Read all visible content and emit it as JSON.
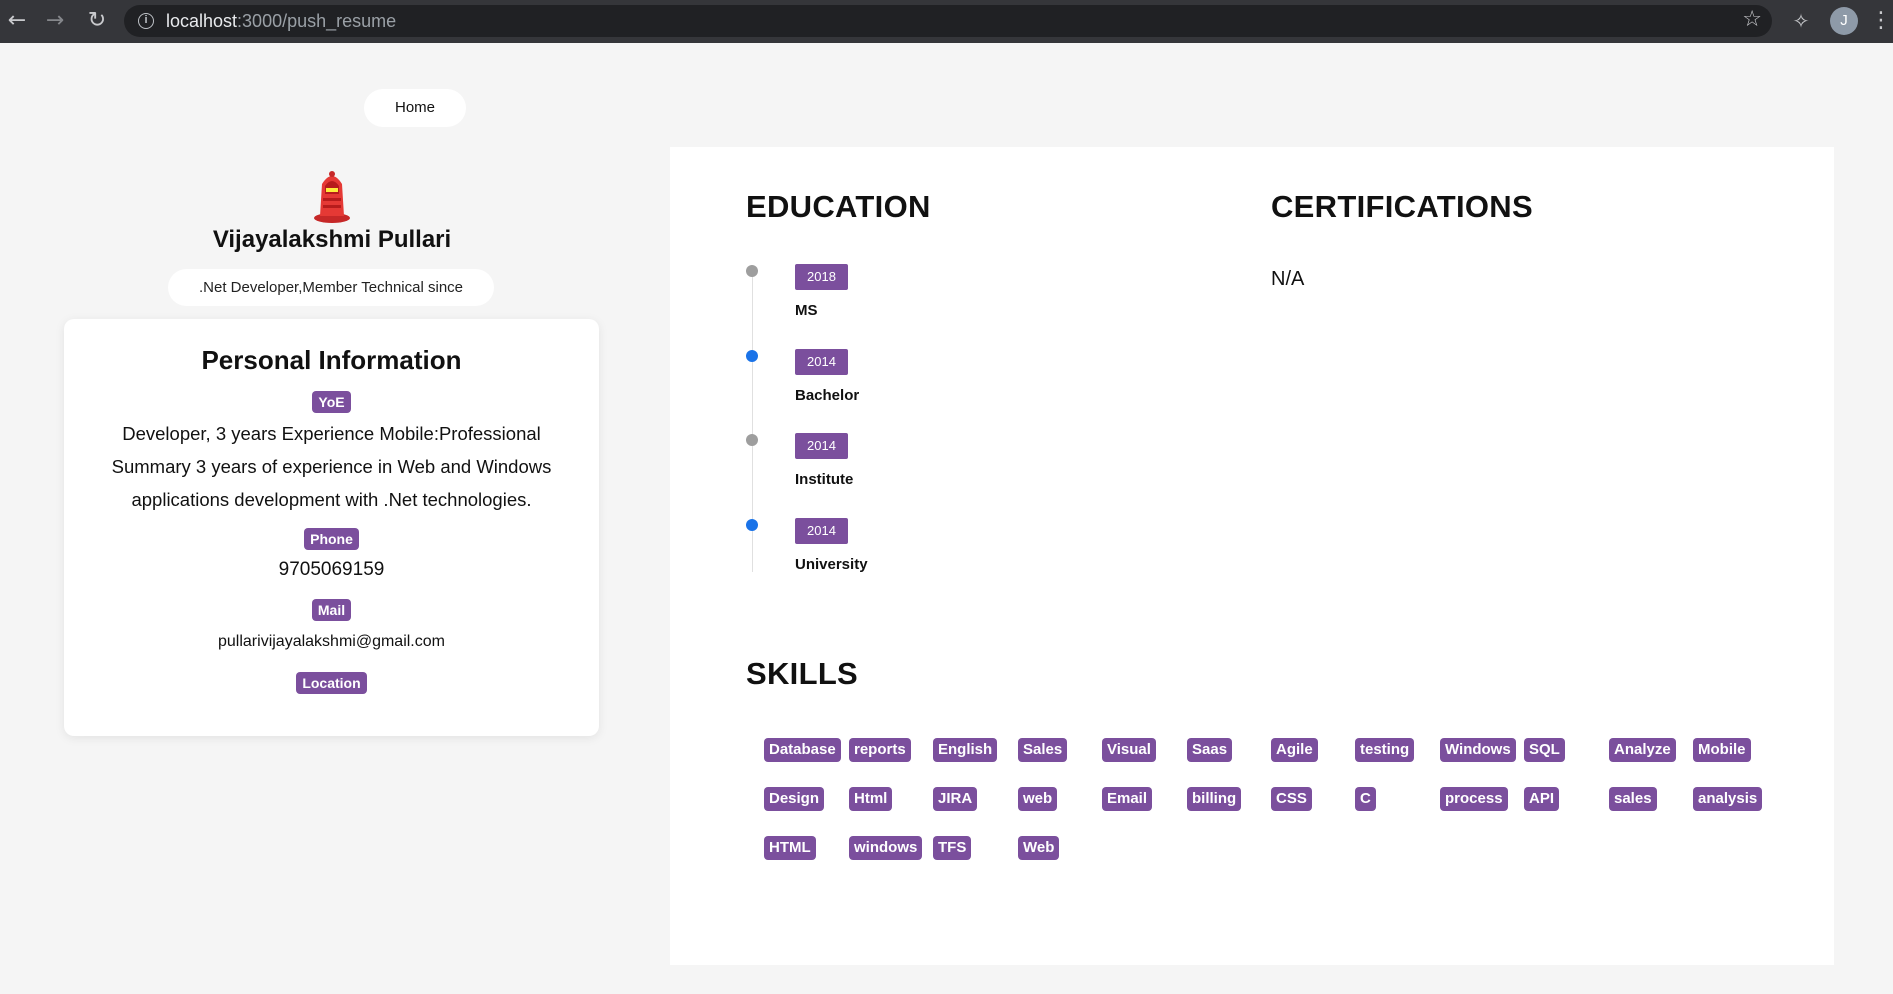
{
  "browser": {
    "url_host": "localhost",
    "url_path": ":3000/push_resume",
    "avatar_letter": "J"
  },
  "home_label": "Home",
  "profile": {
    "name": "Vijayalakshmi Pullari",
    "role": ".Net Developer,Member Technical since"
  },
  "personal": {
    "title": "Personal Information",
    "yoe_label": "YoE",
    "yoe_text": "Developer, 3 years Experience Mobile:Professional Summary 3 years of experience in Web and Windows applications development with .Net technologies.",
    "phone_label": "Phone",
    "phone": "9705069159",
    "mail_label": "Mail",
    "mail": "pullarivijayalakshmi@gmail.com",
    "location_label": "Location"
  },
  "education": {
    "title": "EDUCATION",
    "items": [
      {
        "year": "2018",
        "degree": "MS",
        "dot_color": "#9e9e9e"
      },
      {
        "year": "2014",
        "degree": "Bachelor",
        "dot_color": "#1a73e8"
      },
      {
        "year": "2014",
        "degree": "Institute",
        "dot_color": "#9e9e9e"
      },
      {
        "year": "2014",
        "degree": "University",
        "dot_color": "#1a73e8"
      }
    ]
  },
  "certifications": {
    "title": "CERTIFICATIONS",
    "value": "N/A"
  },
  "skills": {
    "title": "SKILLS",
    "rows": [
      [
        "Database",
        "reports",
        "English",
        "Sales",
        "Visual",
        "Saas",
        "Agile",
        "testing",
        "Windows",
        "SQL",
        "Analyze",
        "Mobile"
      ],
      [
        "Design",
        "Html",
        "JIRA",
        "web",
        "Email",
        "billing",
        "CSS",
        "C",
        "process",
        "API",
        "sales",
        "analysis"
      ],
      [
        "HTML",
        "windows",
        "TFS",
        "Web"
      ]
    ]
  },
  "colors": {
    "badge": "#7b4f9d",
    "chrome_bg": "#35363a"
  }
}
